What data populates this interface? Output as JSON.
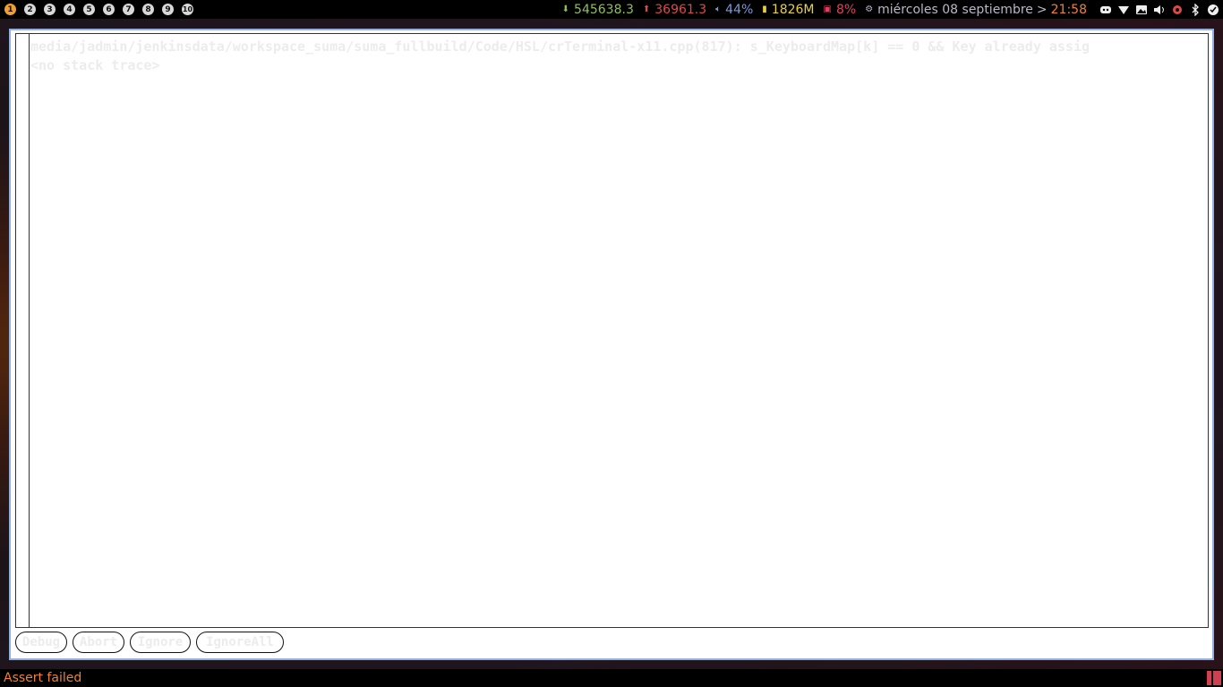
{
  "workspaces": [
    "1",
    "2",
    "3",
    "4",
    "5",
    "6",
    "7",
    "8",
    "9",
    "10"
  ],
  "status": {
    "download": "545638.3",
    "upload": "36961.3",
    "volume": "44%",
    "memory": "1826M",
    "cpu": "8%",
    "date": "miércoles 08 septiembre",
    "separator": ">",
    "time": "21:58"
  },
  "tray_icons": [
    "discord-icon",
    "wifi-icon",
    "image-icon",
    "speaker-icon",
    "bug-icon",
    "bluetooth-icon",
    "checkmark-icon"
  ],
  "dialog": {
    "message_line1": "media/jadmin/jenkinsdata/workspace_suma/suma_fullbuild/Code/HSL/crTerminal-x11.cpp(817): s_KeyboardMap[k] == 0 && Key already assig",
    "message_line2": "<no stack trace>",
    "buttons": {
      "debug": "Debug",
      "abort": "Abort",
      "ignore": "Ignore",
      "ignore_all": "IgnoreAll"
    }
  },
  "window_title": "Assert failed",
  "colors": {
    "accent_active_workspace": "#f0a030",
    "download": "#8fc050",
    "upload": "#e04848",
    "memory": "#e8d040",
    "title": "#f08030"
  }
}
